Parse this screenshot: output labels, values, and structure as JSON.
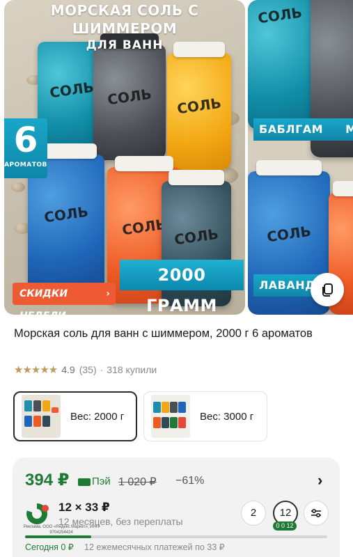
{
  "gallery": {
    "main_slide": {
      "banner_line1": "МОРСКАЯ СОЛЬ С ШИММЕРОМ",
      "banner_line2": "ДЛЯ ВАНН",
      "aromas_number": "6",
      "aromas_label": "АРОМАТОВ",
      "weight_badge": "2000 ГРАММ",
      "promo_label": "СКИДКИ НЕДЕЛИ",
      "promo_arrow": "›",
      "jar_brand": "СОЛЬ"
    },
    "next_slide": {
      "label_top": "БАБЛГАМ",
      "label_top_extra": "М",
      "label_bottom": "ЛАВАНДА",
      "jar_brand": "СОЛЬ"
    },
    "overlay_button_icon": "copy-icon"
  },
  "product": {
    "title": "Морская соль для ванн с шиммером, 2000 г 6 ароматов",
    "rating": {
      "stars": "★★★★★",
      "value": "4.9",
      "reviews": "(35)",
      "separator": "·",
      "purchased": "318 купили",
      "star_color": "#bf9a5c"
    }
  },
  "variants": [
    {
      "label": "Вес: 2000 г",
      "selected": true
    },
    {
      "label": "Вес: 3000 г",
      "selected": false
    }
  ],
  "price": {
    "current": "394 ₽",
    "pay_label": "Пэй",
    "old": "1 020 ₽",
    "discount": "−61%",
    "chevron": "›",
    "accent_color": "#1e7a34",
    "split": {
      "amount": "12 × 33 ₽",
      "description": "12 месяцев, без переплаты",
      "legal": "Реклама. ООО «Яндекс Маркет», ИНН 9704254424",
      "terms": [
        "2",
        "12"
      ],
      "term_tag": "0 0 12",
      "progress_fraction": 0.22,
      "today": "Сегодня 0 ₽",
      "monthly": "12 ежемесячных платежей по 33 ₽"
    }
  }
}
